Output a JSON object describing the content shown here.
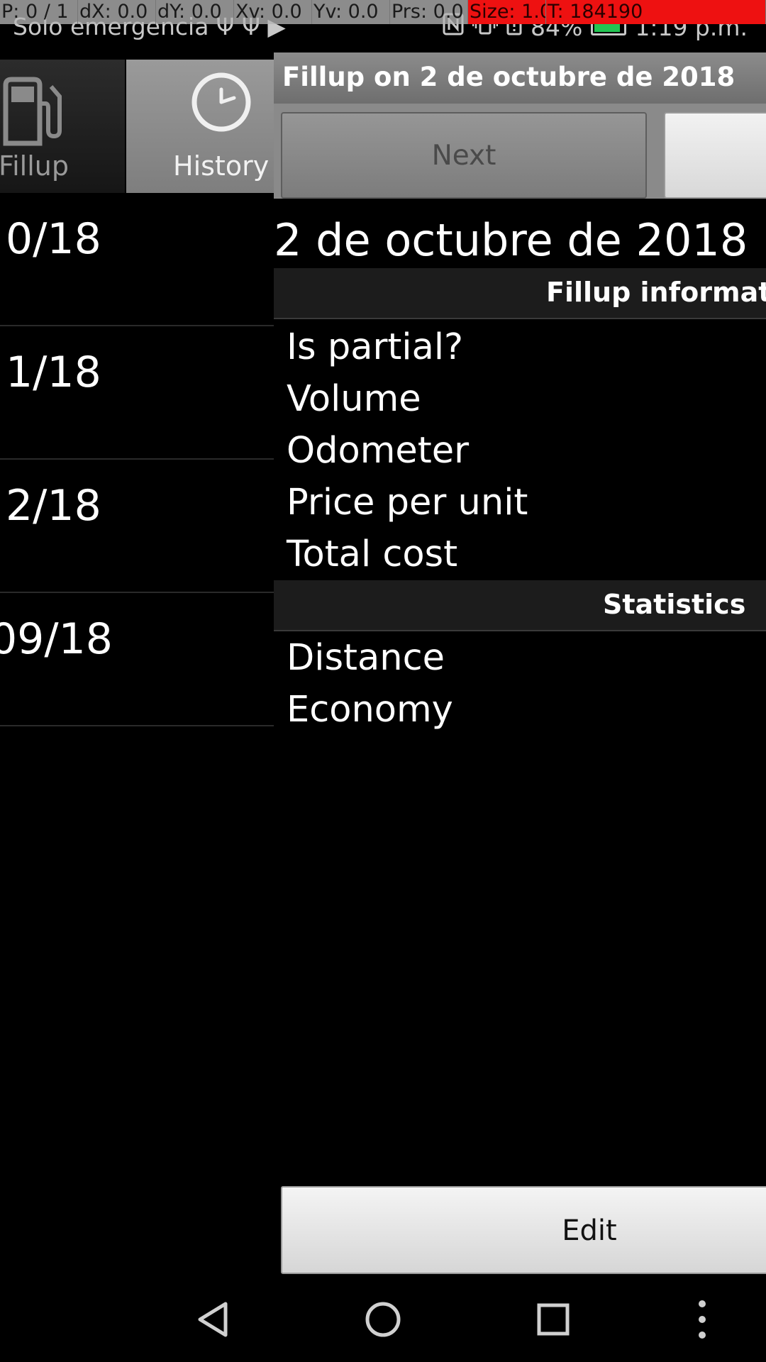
{
  "debug_overlay": {
    "pointer": "P: 0 / 1",
    "dx": "dX: 0.0",
    "dy": "dY: 0.0",
    "xv": "Xv: 0.0",
    "yv": "Yv: 0.0",
    "prs": "Prs: 0.0",
    "size": "Size: 1.0",
    "touch": "T: 184190"
  },
  "status_bar": {
    "carrier": "Solo emergencia",
    "carrier_icons": "Ψ Ψ ▶",
    "battery": "84%",
    "time": "1:19 p.m."
  },
  "tabs": [
    {
      "label": "Fillup",
      "icon": "fuel-pump-icon"
    },
    {
      "label": "History",
      "icon": "clock-icon"
    }
  ],
  "history": {
    "rows": [
      "0/18",
      "1/18",
      "2/18",
      "09/18"
    ]
  },
  "dialog": {
    "title": "Fillup on 2 de octubre de 2018",
    "next_label": "Next",
    "date": "2 de octubre de 2018",
    "sections": {
      "fillup_info": "Fillup informatio",
      "statistics": "Statistics"
    },
    "fillup_fields": [
      "Is partial?",
      "Volume",
      "Odometer",
      "Price per unit",
      "Total cost"
    ],
    "statistics_fields": [
      "Distance",
      "Economy"
    ],
    "edit_label": "Edit"
  },
  "colors": {
    "background": "#000000",
    "debug_highlight": "#ee1111",
    "battery": "#23c553"
  }
}
